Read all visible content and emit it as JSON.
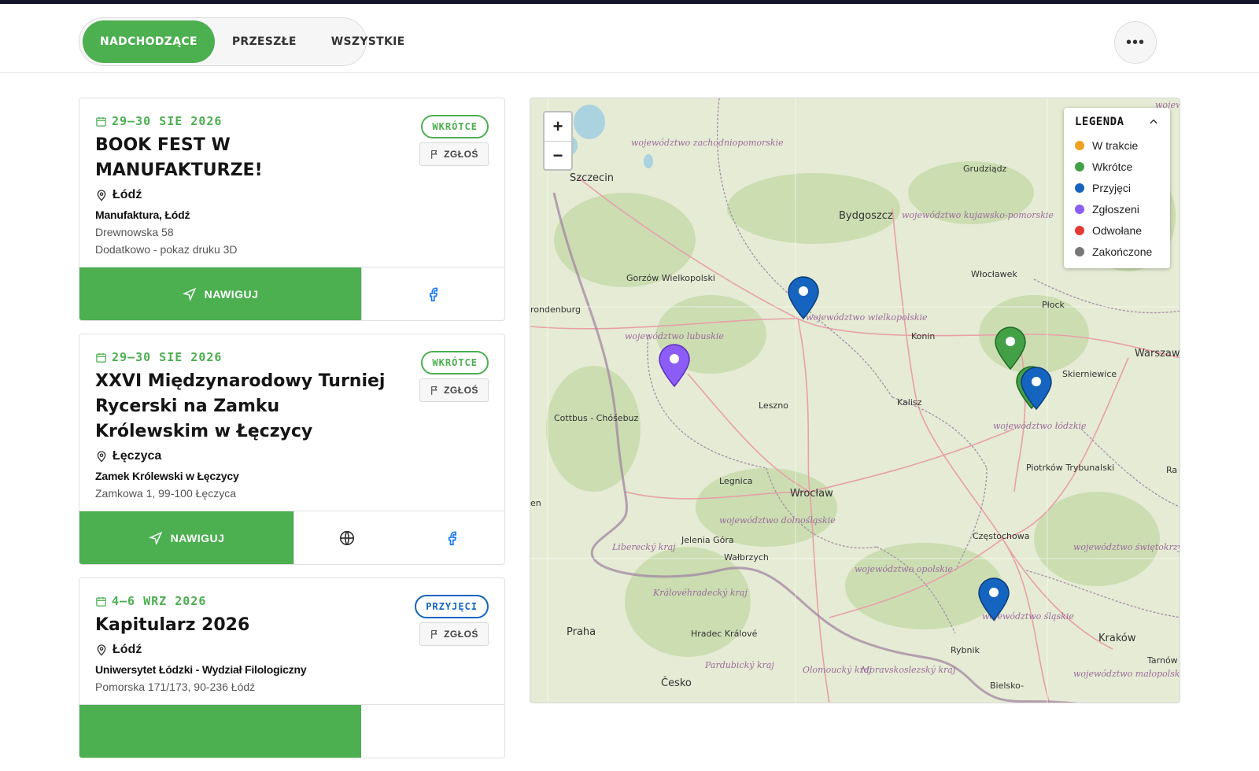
{
  "tabs": [
    {
      "label": "NADCHODZĄCE",
      "active": true
    },
    {
      "label": "PRZESZŁE",
      "active": false
    },
    {
      "label": "WSZYSTKIE",
      "active": false
    }
  ],
  "more_label": "•••",
  "events": [
    {
      "date": "29–30 SIE 2026",
      "title": "BOOK FEST W MANUFAKTURZE!",
      "city": "Łódź",
      "venue": "Manufaktura, Łódź",
      "address": "Drewnowska 58",
      "extra": "Dodatkowo - pokaz druku 3D",
      "badge": "WKRÓTCE",
      "report_label": "ZGŁOŚ",
      "nav_label": "NAWIGUJ"
    },
    {
      "date": "29–30 SIE 2026",
      "title": "XXVI Międzynarodowy Turniej Rycerski na Zamku Królewskim w Łęczycy",
      "city": "Łęczyca",
      "venue": "Zamek Królewski w Łęczycy",
      "address": "Zamkowa 1, 99-100 Łęczyca",
      "badge": "WKRÓTCE",
      "report_label": "ZGŁOŚ",
      "nav_label": "NAWIGUJ"
    },
    {
      "date": "4–6 WRZ 2026",
      "title": "Kapitularz 2026",
      "city": "Łódź",
      "venue": "Uniwersytet Łódzki - Wydział Filologiczny",
      "address": "Pomorska 171/173, 90-236 Łódź",
      "badge": "PRZYJĘCI",
      "report_label": "ZGŁOŚ"
    }
  ],
  "map": {
    "zoom_in": "+",
    "zoom_out": "−",
    "legend_title": "LEGENDA",
    "legend": [
      {
        "label": "W trakcie",
        "color": "#f0a020"
      },
      {
        "label": "Wkrótce",
        "color": "#43a047"
      },
      {
        "label": "Przyjęci",
        "color": "#1565c0"
      },
      {
        "label": "Zgłoszeni",
        "color": "#8b5cf6"
      },
      {
        "label": "Odwołane",
        "color": "#e53935"
      },
      {
        "label": "Zakończone",
        "color": "#777777"
      }
    ],
    "labels": [
      "Szczecin",
      "Bydgoszcz",
      "Grudziądz",
      "Gorzów Wielkopolski",
      "Włocławek",
      "Płock",
      "Konin",
      "Warszawa",
      "Skierniewice",
      "Kalisz",
      "Leszno",
      "Cottbus - Chóśebuz",
      "Legnica",
      "Wrocław",
      "Piotrków Trybunalski",
      "Jelenia Góra",
      "Wałbrzych",
      "Częstochowa",
      "Praha",
      "Hradec Králové",
      "Rybnik",
      "Kraków",
      "Tarnów",
      "Bielsko-",
      "Česko",
      "województwo zachodniopomorskie",
      "województwo kujawsko-pomorskie",
      "województwo wielkopolskie",
      "województwo lubuskie",
      "województwo łódzkie",
      "województwo dolnośląskie",
      "województwo opolskie",
      "województwo śląskie",
      "województwo świętokrzyskie",
      "województwo małopolskie",
      "Liberecký kraj",
      "Královéhradecký kraj",
      "Pardubický kraj",
      "Olomoucký kraj",
      "Moravskoslezský kraj",
      "rondenburg",
      "en",
      "Ra",
      "wojew"
    ]
  }
}
